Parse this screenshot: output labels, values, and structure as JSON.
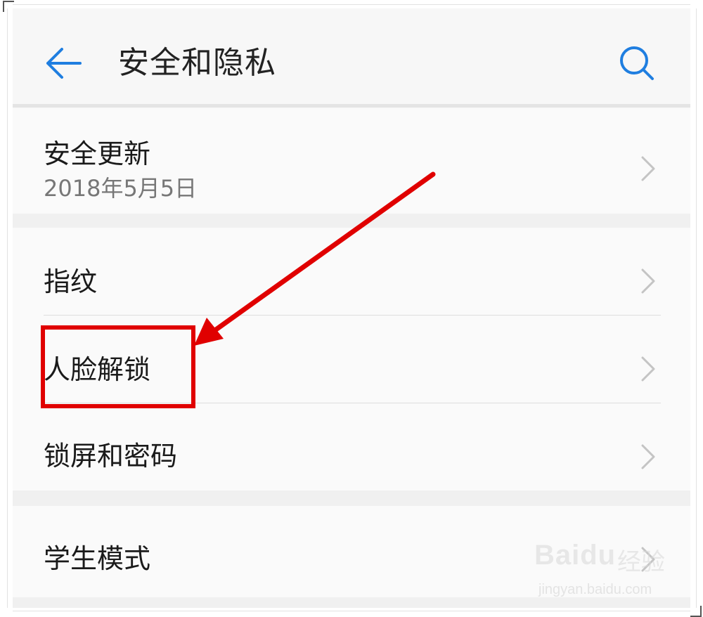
{
  "header": {
    "title": "安全和隐私",
    "back_icon": "arrow-left-icon",
    "search_icon": "search-icon",
    "accent_color": "#1f7ee0"
  },
  "sections": [
    {
      "items": [
        {
          "label": "安全更新",
          "subtitle": "2018年5月5日"
        }
      ]
    },
    {
      "items": [
        {
          "label": "指纹"
        },
        {
          "label": "人脸解锁"
        },
        {
          "label": "锁屏和密码"
        }
      ]
    },
    {
      "items": [
        {
          "label": "学生模式"
        }
      ]
    }
  ],
  "annotation": {
    "color": "#e00000",
    "highlighted_item": "人脸解锁"
  },
  "watermark": {
    "brand": "Baidu",
    "text": "经验",
    "url": "jingyan.baidu.com"
  }
}
